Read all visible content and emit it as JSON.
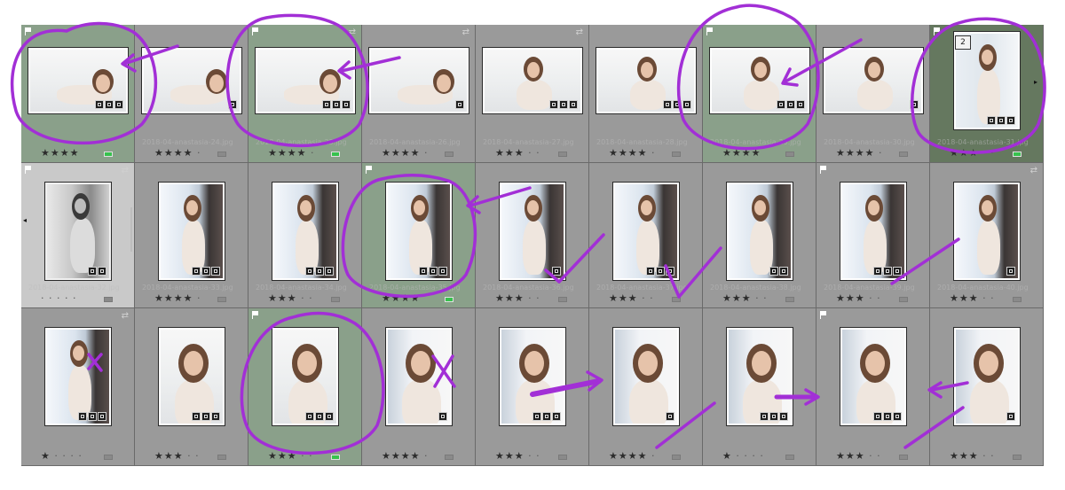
{
  "app": "lightroom-grid-view",
  "colors": {
    "accent_ink": "#a22fd6",
    "pick_green": "#37c24d",
    "selected_cell": "#65785f"
  },
  "grid": {
    "rows": [
      {
        "cells": [
          {
            "state": "picked",
            "orientation": "landscape",
            "pose": "lying",
            "rating": "★★★★",
            "dots": "",
            "label": "green",
            "flag": true,
            "sync": false,
            "badges": 3,
            "filename": ""
          },
          {
            "state": "normal",
            "orientation": "landscape",
            "pose": "lying",
            "rating": "★★★★",
            "dots": "·",
            "label": "",
            "flag": false,
            "sync": false,
            "badges": 1,
            "filename": "2018-04-anastasia-24.jpg"
          },
          {
            "state": "picked",
            "orientation": "landscape",
            "pose": "lying",
            "rating": "★★★★",
            "dots": "·",
            "label": "green",
            "flag": true,
            "sync": true,
            "badges": 3,
            "filename": "2018-04-anastasia-25.jpg"
          },
          {
            "state": "normal",
            "orientation": "landscape",
            "pose": "lying",
            "rating": "★★★★",
            "dots": "·",
            "label": "",
            "flag": false,
            "sync": true,
            "badges": 1,
            "filename": "2018-04-anastasia-26.jpg"
          },
          {
            "state": "normal",
            "orientation": "landscape",
            "pose": "sitting",
            "rating": "★★★",
            "dots": "· ·",
            "label": "",
            "flag": false,
            "sync": true,
            "badges": 3,
            "filename": "2018-04-anastasia-27.jpg"
          },
          {
            "state": "normal",
            "orientation": "landscape",
            "pose": "sitting",
            "rating": "★★★★",
            "dots": "·",
            "label": "",
            "flag": false,
            "sync": false,
            "badges": 3,
            "filename": "2018-04-anastasia-28.jpg"
          },
          {
            "state": "picked",
            "orientation": "landscape",
            "pose": "sitting",
            "rating": "★★★★",
            "dots": "",
            "label": "",
            "flag": true,
            "sync": false,
            "badges": 3,
            "filename": "2018-04-anastasia-29.jpg"
          },
          {
            "state": "normal",
            "orientation": "landscape",
            "pose": "sitting",
            "rating": "★★★★",
            "dots": "·",
            "label": "",
            "flag": false,
            "sync": false,
            "badges": 1,
            "filename": "2018-04-anastasia-30.jpg"
          },
          {
            "state": "selected",
            "orientation": "portrait",
            "pose": "standing",
            "rating": "★★★",
            "dots": "· ·",
            "label": "green",
            "flag": true,
            "sync": false,
            "badges": 3,
            "filename": "2018-04-anastasia-31.jpg",
            "stack_count": "2"
          }
        ]
      },
      {
        "cells": [
          {
            "state": "white",
            "orientation": "portrait",
            "pose": "bw",
            "rating": "",
            "dots": "· · · · ·",
            "label": "",
            "flag": true,
            "sync": true,
            "badges": 2,
            "filename": "2018-04-anastasia-32.jpg"
          },
          {
            "state": "normal",
            "orientation": "portrait",
            "pose": "window",
            "rating": "★★★★",
            "dots": "·",
            "label": "",
            "flag": false,
            "sync": false,
            "badges": 3,
            "filename": "2018-04-anastasia-33.jpg"
          },
          {
            "state": "normal",
            "orientation": "portrait",
            "pose": "window",
            "rating": "★★★",
            "dots": "· ·",
            "label": "",
            "flag": false,
            "sync": false,
            "badges": 3,
            "filename": "2018-04-anastasia-34.jpg"
          },
          {
            "state": "picked",
            "orientation": "portrait",
            "pose": "window",
            "rating": "★★★★",
            "dots": "",
            "label": "green",
            "flag": true,
            "sync": false,
            "badges": 3,
            "filename": "2018-04-anastasia-35.jpg"
          },
          {
            "state": "normal",
            "orientation": "portrait",
            "pose": "window",
            "rating": "★★★",
            "dots": "· ·",
            "label": "",
            "flag": false,
            "sync": false,
            "badges": 1,
            "filename": "2018-04-anastasia-36.jpg"
          },
          {
            "state": "normal",
            "orientation": "portrait",
            "pose": "window",
            "rating": "★★★",
            "dots": "· ·",
            "label": "",
            "flag": false,
            "sync": false,
            "badges": 3,
            "filename": "2018-04-anastasia-37.jpg"
          },
          {
            "state": "normal",
            "orientation": "portrait",
            "pose": "window",
            "rating": "★★★",
            "dots": "· ·",
            "label": "",
            "flag": false,
            "sync": false,
            "badges": 2,
            "filename": "2018-04-anastasia-38.jpg"
          },
          {
            "state": "normal",
            "orientation": "portrait",
            "pose": "window",
            "rating": "★★★",
            "dots": "· ·",
            "label": "",
            "flag": true,
            "sync": false,
            "badges": 3,
            "filename": "2018-04-anastasia-39.jpg"
          },
          {
            "state": "normal",
            "orientation": "portrait",
            "pose": "window",
            "rating": "★★★",
            "dots": "· ·",
            "label": "",
            "flag": false,
            "sync": true,
            "badges": 1,
            "filename": "2018-04-anastasia-40.jpg"
          }
        ]
      },
      {
        "cells": [
          {
            "state": "normal",
            "orientation": "portrait",
            "pose": "window",
            "rating": "★",
            "dots": "· · · ·",
            "label": "",
            "flag": false,
            "sync": true,
            "badges": 3,
            "filename": ""
          },
          {
            "state": "normal",
            "orientation": "portrait",
            "pose": "sitting",
            "rating": "★★★",
            "dots": "· ·",
            "label": "",
            "flag": false,
            "sync": false,
            "badges": 3,
            "filename": ""
          },
          {
            "state": "picked",
            "orientation": "portrait",
            "pose": "sitting",
            "rating": "★★★",
            "dots": "· ·",
            "label": "green",
            "flag": true,
            "sync": false,
            "badges": 3,
            "filename": ""
          },
          {
            "state": "normal",
            "orientation": "portrait",
            "pose": "portrait",
            "rating": "★★★★",
            "dots": "·",
            "label": "",
            "flag": false,
            "sync": false,
            "badges": 1,
            "filename": ""
          },
          {
            "state": "normal",
            "orientation": "portrait",
            "pose": "portrait",
            "rating": "★★★",
            "dots": "· ·",
            "label": "",
            "flag": false,
            "sync": false,
            "badges": 3,
            "filename": ""
          },
          {
            "state": "normal",
            "orientation": "portrait",
            "pose": "portrait",
            "rating": "★★★★",
            "dots": "·",
            "label": "",
            "flag": false,
            "sync": false,
            "badges": 1,
            "filename": ""
          },
          {
            "state": "normal",
            "orientation": "portrait",
            "pose": "portrait",
            "rating": "★",
            "dots": "· · · ·",
            "label": "",
            "flag": false,
            "sync": false,
            "badges": 3,
            "filename": ""
          },
          {
            "state": "normal",
            "orientation": "portrait",
            "pose": "portrait",
            "rating": "★★★",
            "dots": "· ·",
            "label": "",
            "flag": true,
            "sync": false,
            "badges": 3,
            "filename": ""
          },
          {
            "state": "normal",
            "orientation": "portrait",
            "pose": "portrait",
            "rating": "★★★",
            "dots": "· ·",
            "label": "",
            "flag": false,
            "sync": false,
            "badges": 1,
            "filename": ""
          }
        ]
      }
    ]
  }
}
